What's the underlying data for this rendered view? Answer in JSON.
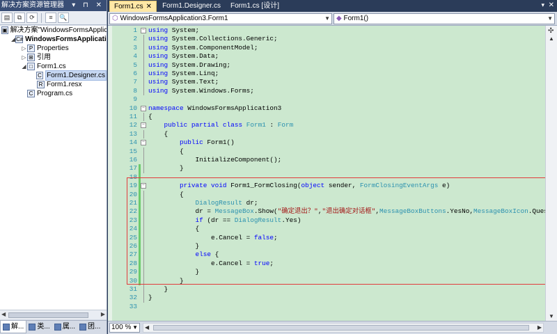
{
  "solution_explorer": {
    "title": "解决方案资源管理器",
    "title_controls": "▾ ⊓ ✕",
    "tree": [
      {
        "label": "解决方案\"WindowsFormsApplicatio",
        "indent": 0,
        "icon": "solution-icon",
        "bold": false
      },
      {
        "label": "WindowsFormsApplication",
        "indent": 1,
        "icon": "project-icon",
        "bold": true
      },
      {
        "label": "Properties",
        "indent": 2,
        "icon": "properties-icon",
        "bold": false
      },
      {
        "label": "引用",
        "indent": 2,
        "icon": "references-icon",
        "bold": false
      },
      {
        "label": "Form1.cs",
        "indent": 2,
        "icon": "form-icon",
        "bold": false
      },
      {
        "label": "Form1.Designer.cs",
        "indent": 3,
        "icon": "cs-file-icon",
        "bold": false,
        "selected": true
      },
      {
        "label": "Form1.resx",
        "indent": 3,
        "icon": "resx-file-icon",
        "bold": false
      },
      {
        "label": "Program.cs",
        "indent": 2,
        "icon": "cs-file-icon",
        "bold": false
      }
    ],
    "bottom_tabs": [
      "解...",
      "类...",
      "属...",
      "团..."
    ]
  },
  "editor": {
    "tabs": [
      {
        "label": "Form1.cs",
        "active": true,
        "closable": true
      },
      {
        "label": "Form1.Designer.cs",
        "active": false
      },
      {
        "label": "Form1.cs [设计]",
        "active": false
      }
    ],
    "close_glyph": "✕",
    "dropdown_glyph": "▾",
    "nav_left": "WindowsFormsApplication3.Form1",
    "nav_right": "Form1()",
    "zoom": "100 %"
  },
  "code": [
    {
      "n": "1",
      "fold": "box-minus",
      "html": "<span class='kw'>using</span> System;"
    },
    {
      "n": "2",
      "fold": "vline",
      "html": "<span class='kw'>using</span> System.Collections.Generic;"
    },
    {
      "n": "3",
      "fold": "vline",
      "html": "<span class='kw'>using</span> System.ComponentModel;"
    },
    {
      "n": "4",
      "fold": "vline",
      "html": "<span class='kw'>using</span> System.Data;"
    },
    {
      "n": "5",
      "fold": "vline",
      "html": "<span class='kw'>using</span> System.Drawing;"
    },
    {
      "n": "6",
      "fold": "vline",
      "html": "<span class='kw'>using</span> System.Linq;"
    },
    {
      "n": "7",
      "fold": "vline",
      "html": "<span class='kw'>using</span> System.Text;"
    },
    {
      "n": "8",
      "fold": "vline",
      "html": "<span class='kw'>using</span> System.Windows.Forms;"
    },
    {
      "n": "9",
      "fold": "",
      "html": ""
    },
    {
      "n": "10",
      "fold": "box-minus",
      "html": "<span class='kw'>namespace</span> WindowsFormsApplication3"
    },
    {
      "n": "11",
      "fold": "vline",
      "html": "{"
    },
    {
      "n": "12",
      "fold": "box-minus",
      "html": "    <span class='kw'>public</span> <span class='kw'>partial</span> <span class='kw'>class</span> <span class='ty'>Form1</span> : <span class='ty'>Form</span>"
    },
    {
      "n": "13",
      "fold": "vline",
      "html": "    {"
    },
    {
      "n": "14",
      "fold": "box-minus",
      "html": "        <span class='kw'>public</span> Form1()"
    },
    {
      "n": "15",
      "fold": "vline",
      "html": "        {"
    },
    {
      "n": "16",
      "fold": "vline",
      "html": "            InitializeComponent();"
    },
    {
      "n": "17",
      "fold": "vline",
      "chg": true,
      "html": "        }"
    },
    {
      "n": "18",
      "fold": "",
      "chg": true,
      "html": ""
    },
    {
      "n": "19",
      "fold": "box-minus",
      "chg": true,
      "html": "        <span class='kw'>private</span> <span class='kw'>void</span> Form1_FormClosing(<span class='kw'>object</span> sender, <span class='ty'>FormClosingEventArgs</span> e)"
    },
    {
      "n": "20",
      "fold": "vline",
      "chg": true,
      "html": "        {"
    },
    {
      "n": "21",
      "fold": "vline",
      "chg": true,
      "html": "            <span class='ty'>DialogResult</span> dr;"
    },
    {
      "n": "22",
      "fold": "vline",
      "chg": true,
      "html": "            dr = <span class='ty'>MessageBox</span>.Show(<span class='st'>\"确定退出？\"</span>,<span class='st'>\"退出确定对话框\"</span>,<span class='ty'>MessageBoxButtons</span>.YesNo,<span class='ty'>MessageBoxIcon</span>.Ques"
    },
    {
      "n": "23",
      "fold": "vline",
      "chg": true,
      "html": "            <span class='kw'>if</span> (dr == <span class='ty'>DialogResult</span>.Yes)"
    },
    {
      "n": "24",
      "fold": "vline",
      "chg": true,
      "html": "            {"
    },
    {
      "n": "25",
      "fold": "vline",
      "chg": true,
      "html": "                e.Cancel = <span class='kw'>false</span>;"
    },
    {
      "n": "26",
      "fold": "vline",
      "chg": true,
      "html": "            }"
    },
    {
      "n": "27",
      "fold": "vline",
      "chg": true,
      "html": "            <span class='kw'>else</span> {"
    },
    {
      "n": "28",
      "fold": "vline",
      "chg": true,
      "html": "                e.Cancel = <span class='kw'>true</span>;"
    },
    {
      "n": "29",
      "fold": "vline",
      "chg": true,
      "html": "            }"
    },
    {
      "n": "30",
      "fold": "vline",
      "chg": true,
      "html": "        }"
    },
    {
      "n": "31",
      "fold": "vline",
      "html": "    }"
    },
    {
      "n": "32",
      "fold": "vline",
      "html": "}"
    },
    {
      "n": "33",
      "fold": "",
      "html": ""
    }
  ],
  "colors": {
    "code_bg": "#cce8cf",
    "keyword": "#0000ff",
    "type": "#2b91af",
    "string": "#a31515",
    "highlight_border": "#e23b3b",
    "active_tab": "#ffe8a6"
  }
}
